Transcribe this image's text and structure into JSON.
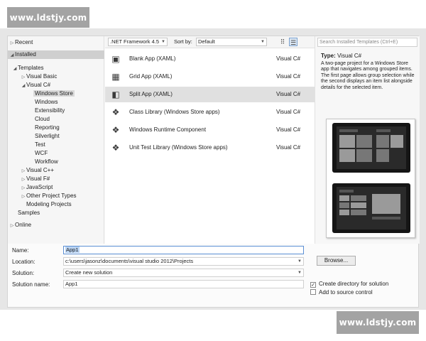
{
  "watermark": {
    "top": "www.ldstjy.com",
    "bottom": "www.ldstjy.com"
  },
  "tree": [
    {
      "label": "Recent",
      "arrow": "▷"
    },
    {
      "label": "Installed",
      "arrow": "◢"
    },
    {
      "label": "Templates",
      "arrow": "◢"
    },
    {
      "label": "Visual Basic",
      "arrow": "▷"
    },
    {
      "label": "Visual C#",
      "arrow": "◢"
    },
    {
      "label": "Windows Store",
      "arrow": ""
    },
    {
      "label": "Windows",
      "arrow": ""
    },
    {
      "label": "Extensibility",
      "arrow": ""
    },
    {
      "label": "Cloud",
      "arrow": ""
    },
    {
      "label": "Reporting",
      "arrow": ""
    },
    {
      "label": "Silverlight",
      "arrow": ""
    },
    {
      "label": "Test",
      "arrow": ""
    },
    {
      "label": "WCF",
      "arrow": ""
    },
    {
      "label": "Workflow",
      "arrow": ""
    },
    {
      "label": "Visual C++",
      "arrow": "▷"
    },
    {
      "label": "Visual F#",
      "arrow": "▷"
    },
    {
      "label": "JavaScript",
      "arrow": "▷"
    },
    {
      "label": "Other Project Types",
      "arrow": "▷"
    },
    {
      "label": "Modeling Projects",
      "arrow": ""
    },
    {
      "label": "Samples",
      "arrow": ""
    },
    {
      "label": "Online",
      "arrow": "▷"
    }
  ],
  "toolbar": {
    "framework": ".NET Framework 4.5",
    "sort_label": "Sort by:",
    "sort_value": "Default",
    "small_icons_glyph": "⠿",
    "list_view_glyph": "☰"
  },
  "templates": [
    {
      "name": "Blank App (XAML)",
      "lang": "Visual C#",
      "icon": "blank-app-icon",
      "glyph": "▣"
    },
    {
      "name": "Grid App (XAML)",
      "lang": "Visual C#",
      "icon": "grid-app-icon",
      "glyph": "▦"
    },
    {
      "name": "Split App (XAML)",
      "lang": "Visual C#",
      "icon": "split-app-icon",
      "glyph": "◧"
    },
    {
      "name": "Class Library (Windows Store apps)",
      "lang": "Visual C#",
      "icon": "class-library-icon",
      "glyph": "❖"
    },
    {
      "name": "Windows Runtime Component",
      "lang": "Visual C#",
      "icon": "runtime-component-icon",
      "glyph": "❖"
    },
    {
      "name": "Unit Test Library (Windows Store apps)",
      "lang": "Visual C#",
      "icon": "unit-test-icon",
      "glyph": "❖"
    }
  ],
  "details": {
    "search_placeholder": "Search Installed Templates (Ctrl+E)",
    "type_label": "Type:",
    "type_value": "Visual C#",
    "description": "A two-page project for a Windows Store app that navigates among grouped items. The first page allows group selection while the second displays an item list alongside details for the selected item."
  },
  "form": {
    "name_label": "Name:",
    "name_value": "App1",
    "location_label": "Location:",
    "location_value": "c:\\users\\jasonz\\documents\\visual studio 2012\\Projects",
    "solution_label": "Solution:",
    "solution_value": "Create new solution",
    "solution_name_label": "Solution name:",
    "solution_name_value": "App1",
    "browse_label": "Browse...",
    "create_dir_label": "Create directory for solution",
    "create_dir_checked": "✓",
    "add_source_label": "Add to source control"
  }
}
